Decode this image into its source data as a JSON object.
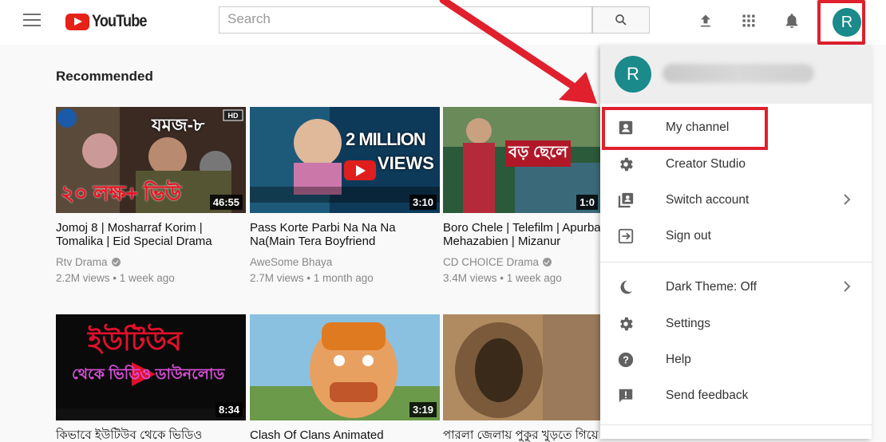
{
  "header": {
    "logo_text": "YouTube",
    "search_placeholder": "Search",
    "avatar_letter": "R"
  },
  "section_title": "Recommended",
  "videos": [
    {
      "title": "Jomoj 8 | Mosharraf Korim | Tomalika | Eid Special Drama",
      "channel": "Rtv Drama",
      "verified": true,
      "meta": "2.2M views • 1 week ago",
      "duration": "46:55",
      "thumb_text": "যমজ-৮",
      "thumb_text2": "২০ লক্ষ+ ভিউ"
    },
    {
      "title": "Pass Korte Parbi Na Na Na Na(Main Tera Boyfriend",
      "channel": "AweSome Bhaya",
      "verified": false,
      "meta": "2.7M views • 1 month ago",
      "duration": "3:10",
      "thumb_text": "2 MILLION",
      "thumb_text2": "VIEWS"
    },
    {
      "title": "Boro Chele | Telefilm | Apurba | Mehazabien | Mizanur",
      "channel": "CD CHOICE Drama",
      "verified": true,
      "meta": "3.4M views • 1 week ago",
      "duration": "1:0",
      "thumb_text": "বড় ছেলে",
      "thumb_text2": ""
    },
    {
      "title": "কিভাবে ইউটিউব থেকে ভিডিও",
      "channel": "",
      "verified": false,
      "meta": "",
      "duration": "8:34",
      "thumb_text": "ইউটিউব",
      "thumb_text2": "থেকে ভিডিও ডাউনলোড"
    },
    {
      "title": "Clash Of Clans Animated",
      "channel": "",
      "verified": false,
      "meta": "",
      "duration": "3:19",
      "thumb_text": "",
      "thumb_text2": ""
    },
    {
      "title": "পারলা জেলায় পুকুর খুড়তে গিয়ে",
      "channel": "",
      "verified": false,
      "meta": "",
      "duration": "",
      "thumb_text": "",
      "thumb_text2": ""
    }
  ],
  "menu": {
    "avatar_letter": "R",
    "items": [
      {
        "label": "My channel",
        "icon": "account-box-icon",
        "chevron": false
      },
      {
        "label": "Creator Studio",
        "icon": "gear-icon",
        "chevron": false
      },
      {
        "label": "Switch account",
        "icon": "switch-account-icon",
        "chevron": true
      },
      {
        "label": "Sign out",
        "icon": "sign-out-icon",
        "chevron": false
      },
      {
        "label": "Dark Theme: Off",
        "icon": "moon-icon",
        "chevron": true
      },
      {
        "label": "Settings",
        "icon": "gear-icon",
        "chevron": false
      },
      {
        "label": "Help",
        "icon": "help-icon",
        "chevron": false
      },
      {
        "label": "Send feedback",
        "icon": "feedback-icon",
        "chevron": false
      }
    ]
  },
  "colors": {
    "brand_red": "#e62117",
    "annotation_red": "#e0202d",
    "avatar_teal": "#1a8a8a"
  }
}
